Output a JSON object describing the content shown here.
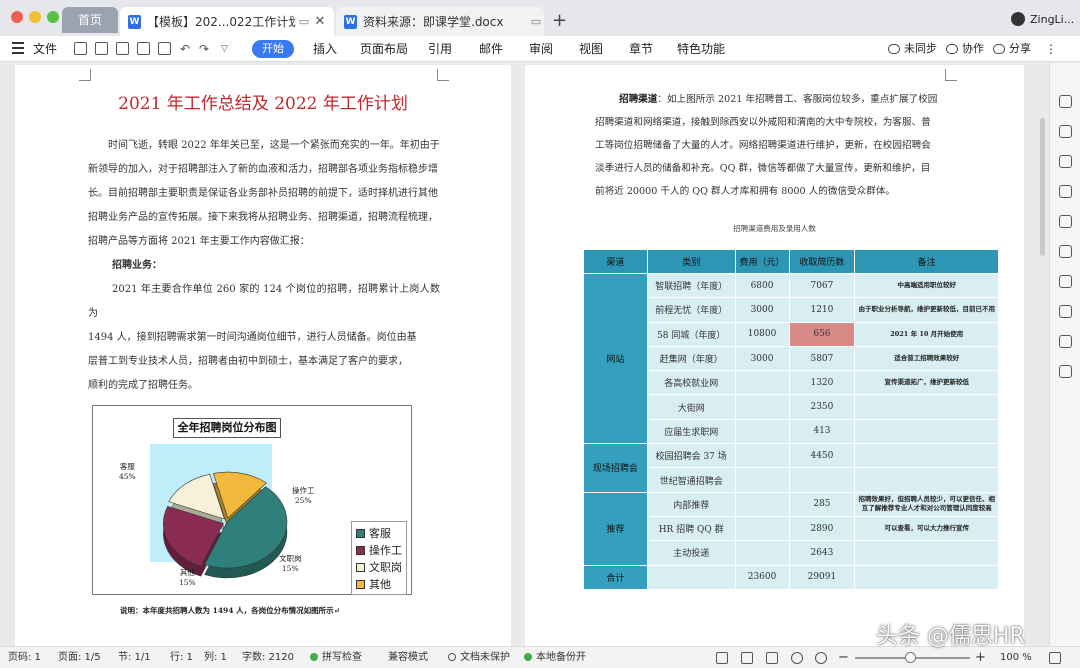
{
  "window": {
    "home_tab": "首页",
    "tabs": [
      {
        "label": "【模板】202...022工作计划",
        "active": true
      },
      {
        "label": "资料来源：即课学堂.docx",
        "active": false
      }
    ],
    "user": "ZingLi..."
  },
  "menubar": {
    "file": "文件",
    "start": "开始",
    "items": [
      "插入",
      "页面布局",
      "引用",
      "邮件",
      "审阅",
      "视图",
      "章节",
      "特色功能"
    ],
    "sync": "未同步",
    "collab": "协作",
    "share": "分享"
  },
  "doc": {
    "title": "2021 年工作总结及 2022 年工作计划",
    "intro_lines": [
      "时间飞逝，转眼 2022 年年关已至，这是一个紧张而充实的一年。年初由于",
      "新领导的加入，对于招聘部注入了新的血液和活力，招聘部各项业务指标稳步增",
      "长。目前招聘部主要职责是保证各业务部补员招聘的前提下，适时择机进行其他",
      "招聘业务产品的宣传拓展。接下来我将从招聘业务、招聘渠道，招聘流程梳理，",
      "招聘产品等方面将 2021 年主要工作内容做汇报："
    ],
    "section1_heading": "招聘业务：",
    "section1_lines": [
      "2021 年主要合作单位 260 家的 124 个岗位的招聘，招聘累计上岗人数为",
      "1494 人，接到招聘需求第一时间沟通岗位细节，进行人员储备。岗位由基",
      "层普工到专业技术人员，招聘者由初中到硕士，基本满足了客户的要求，",
      "顺利的完成了招聘任务。"
    ],
    "chart_caption": "说明：本年度共招聘人数为 1494 人，各岗位分布情况如图所示↵",
    "right_heading": "招聘渠道",
    "right_lines": [
      "：如上图所示 2021 年招聘普工、客服岗位较多，重点扩展了校园",
      "招聘渠道和网络渠道，接触到除西安以外咸阳和渭南的大中专院校，为客服、普",
      "工等岗位招聘储备了大量的人才。网络招聘渠道进行维护，更新，在校园招聘会",
      "淡季进行人员的储备和补充。QQ 群，微信等都做了大量宣传，更新和维护，目",
      "前将近 20000 千人的 QQ 群人才库和拥有 8000 人的微信受众群体。"
    ],
    "table_caption": "招聘渠道费用及录用人数",
    "table": {
      "headers": [
        "渠道",
        "类别",
        "费用（元）",
        "收取简历数",
        "备注"
      ],
      "rows": [
        {
          "channel": "网站",
          "span": 7,
          "cat": "智联招聘（年度）",
          "cost": "6800",
          "resumes": "7067",
          "note": "中高端适用职位较好"
        },
        {
          "cat": "前程无忧（年度）",
          "cost": "3000",
          "resumes": "1210",
          "note": "由于职业分析导航，维护更新较低，目前已不用"
        },
        {
          "cat": "58 同城（年度）",
          "cost": "10800",
          "resumes": "656",
          "note": "2021 年 10 月开始使用",
          "highlight": true
        },
        {
          "cat": "赶集网（年度）",
          "cost": "3000",
          "resumes": "5807",
          "note": "适合普工招聘效果较好"
        },
        {
          "cat": "各高校就业网",
          "cost": "",
          "resumes": "1320",
          "note": "宣传渠道拓广，维护更新较低"
        },
        {
          "cat": "大街网",
          "cost": "",
          "resumes": "2350",
          "note": ""
        },
        {
          "cat": "应届生求职网",
          "cost": "",
          "resumes": "413",
          "note": ""
        },
        {
          "channel": "现场招聘会",
          "span": 2,
          "cat": "校园招聘会 37 场",
          "cost": "",
          "resumes": "4450",
          "note": ""
        },
        {
          "cat": "世纪智通招聘会",
          "cost": "",
          "resumes": "",
          "note": ""
        },
        {
          "channel": "推荐",
          "span": 3,
          "cat": "内部推荐",
          "cost": "",
          "resumes": "285",
          "note": "招聘效果好，但招聘人员较少，可以更信任、相互了解推荐专业人才和对公司管理认同度较高"
        },
        {
          "cat": "HR 招聘 QQ 群",
          "cost": "",
          "resumes": "2890",
          "note": "可以查看，可以大力推行宣传"
        },
        {
          "cat": "主动投递",
          "cost": "",
          "resumes": "2643",
          "note": ""
        },
        {
          "channel": "合计",
          "span": 1,
          "cat": "",
          "cost": "23600",
          "resumes": "29091",
          "note": ""
        }
      ]
    }
  },
  "pie_chart": {
    "title": "全年招聘岗位分布图",
    "slices": [
      {
        "name": "客服",
        "percent": 45,
        "color": "#2f7f7a"
      },
      {
        "name": "操作工",
        "percent": 25,
        "color": "#8a2c52"
      },
      {
        "name": "文职岗",
        "percent": 15,
        "color": "#f6f1d8"
      },
      {
        "name": "其他",
        "percent": 15,
        "color": "#f2b93c"
      }
    ],
    "labels": {
      "kefu": "客服",
      "kefu_pct": "45%",
      "czg": "操作工",
      "czg_pct": "25%",
      "wzg": "文职岗",
      "wzg_pct": "15%",
      "qt": "其他",
      "qt_pct": "15%"
    }
  },
  "status": {
    "pages": "页码: 1",
    "page_of": "页面: 1/5",
    "section": "节: 1/1",
    "row": "行: 1",
    "col": "列: 1",
    "words": "字数: 2120",
    "spell": "拼写检查",
    "compat": "兼容模式",
    "protect": "文档未保护",
    "backup": "本地备份开",
    "zoom": "100 %",
    "watermark": "头条 @儒思HR"
  }
}
